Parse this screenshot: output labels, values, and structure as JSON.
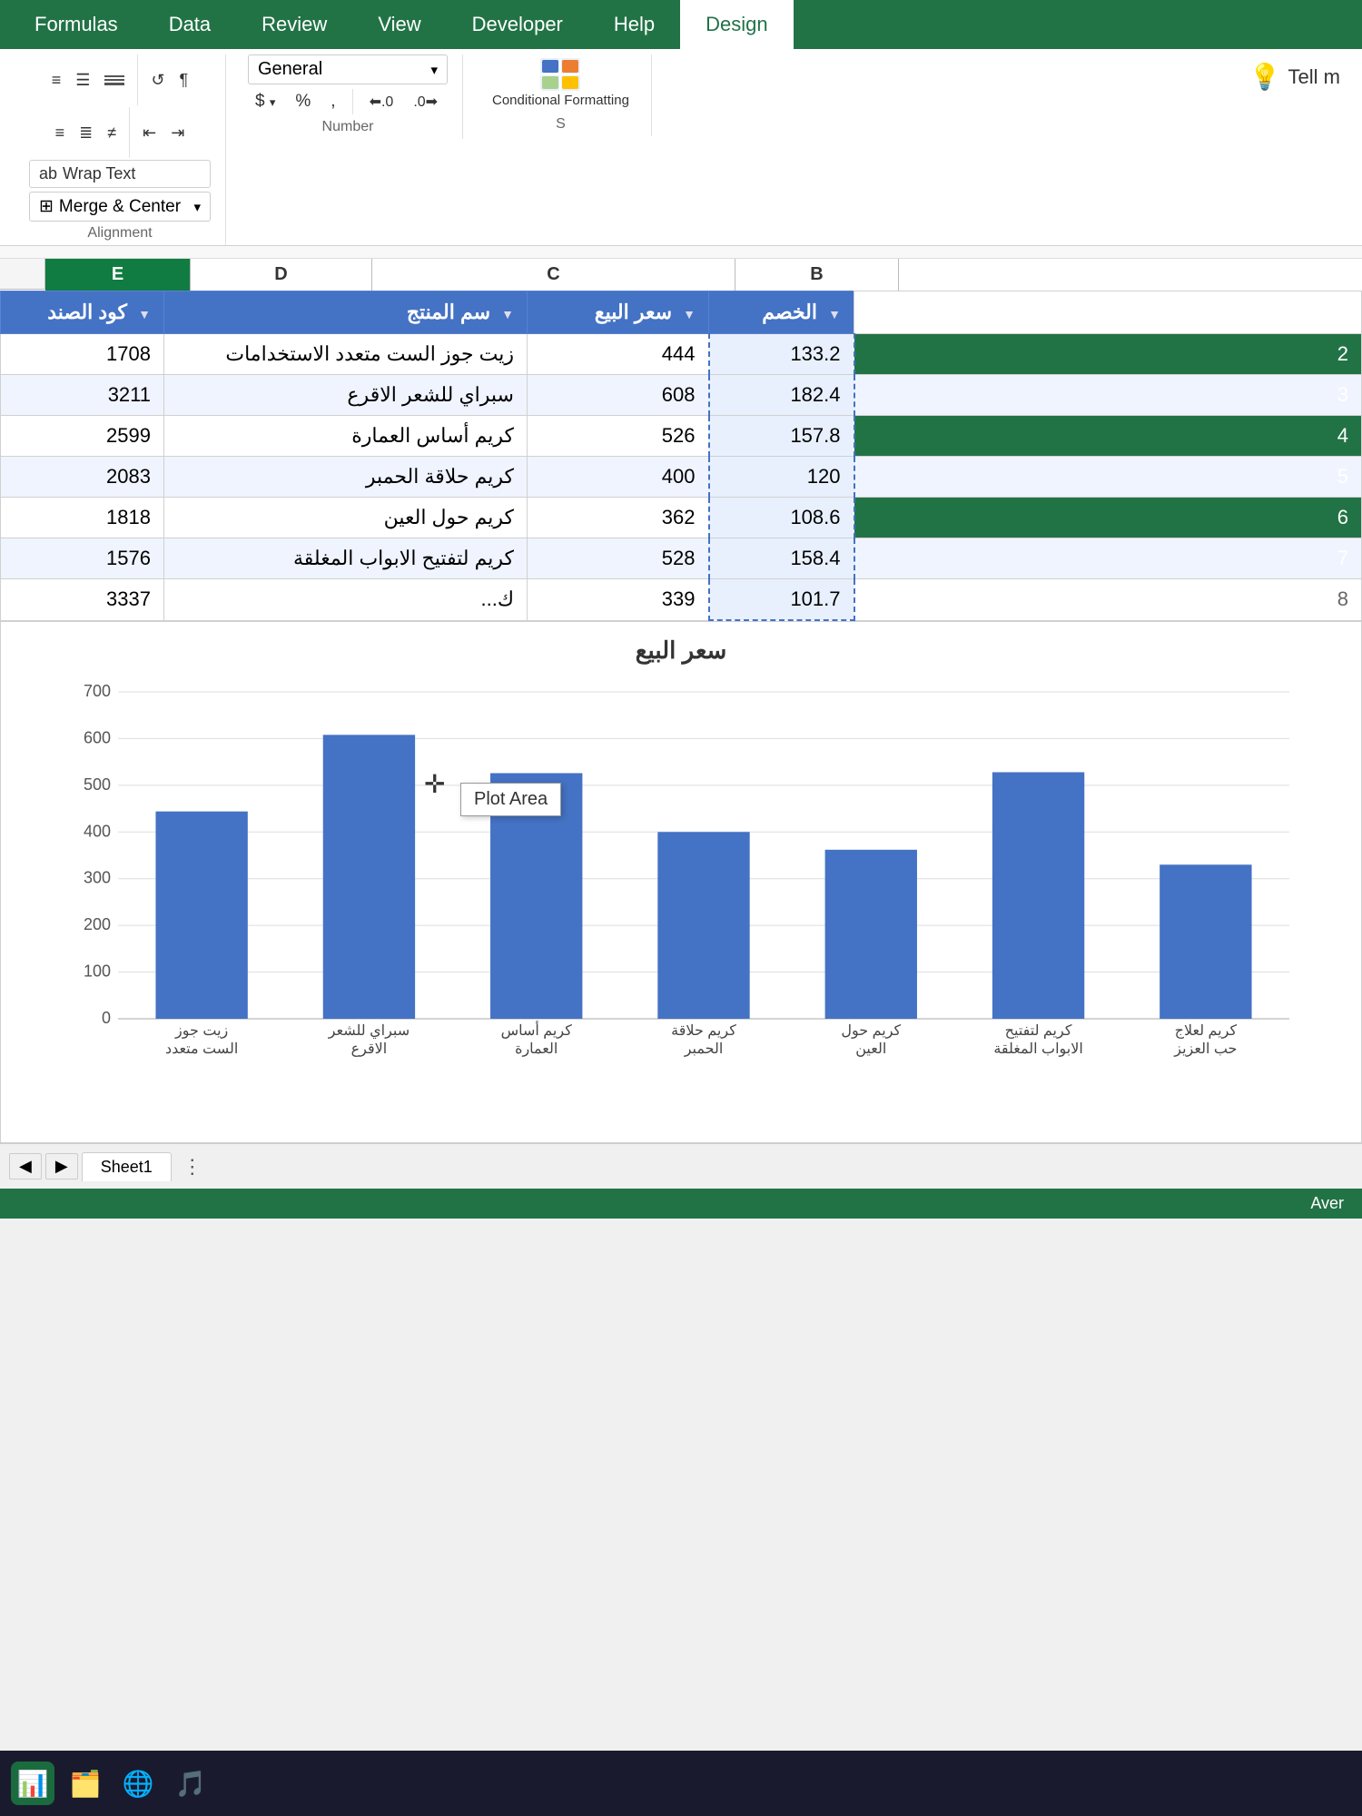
{
  "ribbon": {
    "tabs": [
      "Formulas",
      "Data",
      "Review",
      "View",
      "Developer",
      "Help",
      "Design"
    ],
    "active_tab": "Design",
    "alignment_group_label": "Alignment",
    "number_group_label": "Number",
    "styles_group_label": "S",
    "wrap_text_label": "Wrap Text",
    "merge_center_label": "Merge & Center",
    "general_label": "General",
    "conditional_formatting_label": "Conditional Formatting",
    "tell_me_label": "Tell m",
    "dollar_sign": "$",
    "percent_sign": "%",
    "comma_sign": ","
  },
  "columns": {
    "headers": [
      "E",
      "D",
      "C",
      "B"
    ],
    "widths": [
      160,
      200,
      380,
      160
    ]
  },
  "table": {
    "headers": [
      {
        "label": "الخصم",
        "has_filter": true
      },
      {
        "label": "سعر البيع",
        "has_filter": true
      },
      {
        "label": "سم المنتج",
        "has_filter": true
      },
      {
        "label": "كود الصند",
        "has_filter": true
      }
    ],
    "rows": [
      {
        "discount": "133.2",
        "price": "444",
        "product": "زيت جوز الست متعدد الاستخدامات",
        "code": "1708"
      },
      {
        "discount": "182.4",
        "price": "608",
        "product": "سبراي للشعر الاقرع",
        "code": "3211"
      },
      {
        "discount": "157.8",
        "price": "526",
        "product": "كريم أساس العمارة",
        "code": "2599"
      },
      {
        "discount": "120",
        "price": "400",
        "product": "كريم حلاقة الحمبر",
        "code": "2083"
      },
      {
        "discount": "108.6",
        "price": "362",
        "product": "كريم حول العين",
        "code": "1818"
      },
      {
        "discount": "158.4",
        "price": "528",
        "product": "كريم لتفتيح الابواب المغلقة",
        "code": "1576"
      },
      {
        "discount": "101.7",
        "price": "339",
        "product": "ك...",
        "code": "3337"
      }
    ]
  },
  "chart": {
    "title": "سعر البيع",
    "y_axis": {
      "max": 700,
      "ticks": [
        0,
        100,
        200,
        300,
        400,
        500,
        600,
        700
      ]
    },
    "bars": [
      {
        "label": "زيت جوز الست متعدد",
        "value": 444
      },
      {
        "label": "سبراي للشعر الاقرع",
        "value": 608
      },
      {
        "label": "كريم أساس العمارة",
        "value": 526
      },
      {
        "label": "كريم حلاقة الحمبر",
        "value": 400
      },
      {
        "label": "كريم حول العين",
        "value": 362
      },
      {
        "label": "كريم لتفتيح الابواب المغلقة",
        "value": 528
      },
      {
        "label": "كريم لعلاج حب العزيز",
        "value": 330
      }
    ],
    "bar_color": "#4472c4",
    "plot_area_tooltip": "Plot Area"
  },
  "sheet_tabs": {
    "tabs": [
      "Sheet1"
    ]
  },
  "status_bar": {
    "average_label": "Aver"
  },
  "taskbar": {
    "icons": [
      "🗂️",
      "📁",
      "🌐",
      "🎵",
      "📊"
    ]
  }
}
